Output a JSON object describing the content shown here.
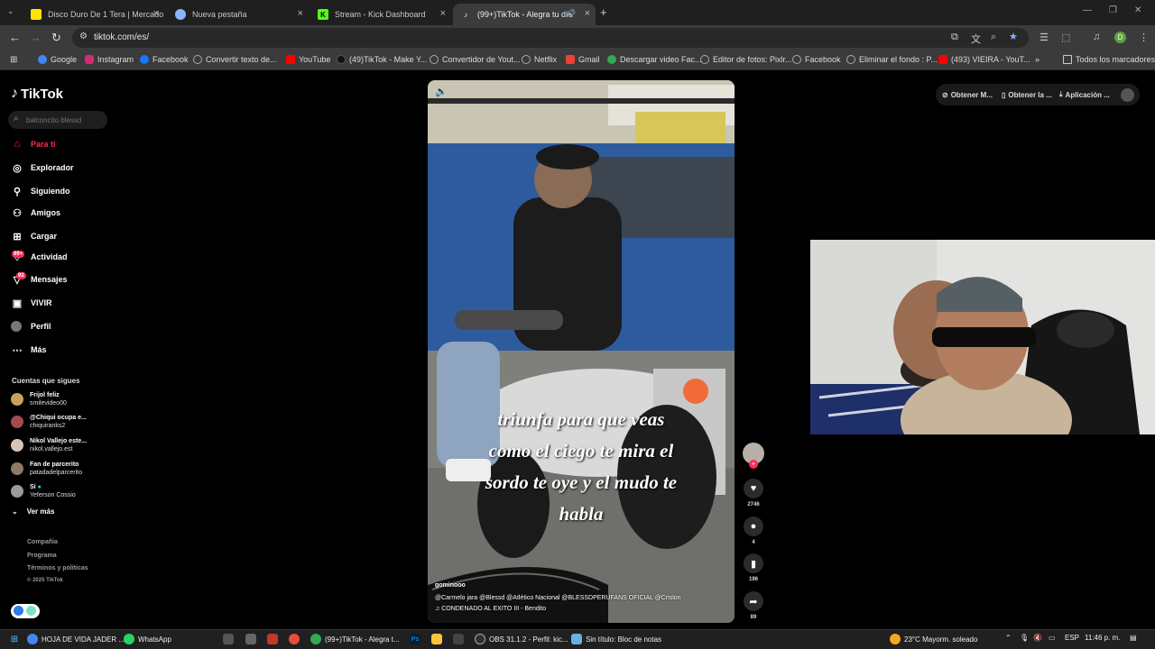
{
  "tabs": [
    {
      "title": "Disco Duro De 1 Tera | Mercado",
      "icon": "mercadolibre-icon",
      "color": "#ffe600"
    },
    {
      "title": "Nueva pestaña",
      "icon": "chrome-icon",
      "color": "#8ab4f8"
    },
    {
      "title": "Stream - Kick Dashboard",
      "icon": "kick-icon",
      "color": "#53fc18"
    },
    {
      "title": "(99+)TikTok - Alegra tu día",
      "icon": "tiktok-icon",
      "color": "#000000"
    }
  ],
  "address_bar": {
    "url": "tiktok.com/es/"
  },
  "bookmarks": [
    {
      "label": "Google",
      "color": "#4285f4"
    },
    {
      "label": "Instagram",
      "color": "#d62976"
    },
    {
      "label": "Facebook",
      "color": "#1877f2"
    },
    {
      "label": "Convertir texto de...",
      "color": "#9aa0a6"
    },
    {
      "label": "YouTube",
      "color": "#ff0000"
    },
    {
      "label": "(49)TikTok - Make Y...",
      "color": "#111111"
    },
    {
      "label": "Convertidor de Yout...",
      "color": "#9aa0a6"
    },
    {
      "label": "Netflix",
      "color": "#9aa0a6"
    },
    {
      "label": "Gmail",
      "color": "#ea4335"
    },
    {
      "label": "Descargar video Fac...",
      "color": "#34a853"
    },
    {
      "label": "Editor de fotos: Pixlr...",
      "color": "#9aa0a6"
    },
    {
      "label": "Facebook",
      "color": "#9aa0a6"
    },
    {
      "label": "Eliminar el fondo : P...",
      "color": "#9aa0a6"
    },
    {
      "label": "(493) VIEIRA - YouT...",
      "color": "#ff0000"
    }
  ],
  "bookmarks_all": "Todos los marcadores",
  "tiktok": {
    "logo": "TikTok",
    "search_placeholder": "balconcito blessd",
    "nav": [
      {
        "label": "Para ti",
        "icon": "home-icon",
        "badge": ""
      },
      {
        "label": "Explorador",
        "icon": "compass-icon",
        "badge": ""
      },
      {
        "label": "Siguiendo",
        "icon": "following-icon",
        "badge": ""
      },
      {
        "label": "Amigos",
        "icon": "friends-icon",
        "badge": ""
      },
      {
        "label": "Cargar",
        "icon": "upload-icon",
        "badge": ""
      },
      {
        "label": "Actividad",
        "icon": "activity-icon",
        "badge": "99+"
      },
      {
        "label": "Mensajes",
        "icon": "messages-icon",
        "badge": "92"
      },
      {
        "label": "VIVIR",
        "icon": "live-icon",
        "badge": ""
      },
      {
        "label": "Perfil",
        "icon": "profile-icon",
        "badge": ""
      },
      {
        "label": "Más",
        "icon": "more-icon",
        "badge": ""
      }
    ],
    "following_header": "Cuentas que sigues",
    "following": [
      {
        "name": "Frijol feliz",
        "user": "smilevideo00"
      },
      {
        "name": "@Chiqui ocupa e...",
        "user": "chiquiranks2"
      },
      {
        "name": "Nikol Vallejo este...",
        "user": "nikol.vallejo.est"
      },
      {
        "name": "Fan de parcerito",
        "user": "patadadelparcerito"
      },
      {
        "name": "Sí",
        "user": "Yeferson Cossio"
      }
    ],
    "see_more": "Ver más",
    "footer": [
      "Compañía",
      "Programa",
      "Términos y políticas",
      "© 2025 TikTok"
    ],
    "top_right": [
      "Obtener M...",
      "Obtener la ...",
      "Aplicación ..."
    ],
    "video": {
      "caption_lines": [
        "triunfa para que veas",
        "como el ciego te mira el",
        "sordo te oye y el mudo  te",
        "habla"
      ],
      "author": "gominooo",
      "description": "@Carmelo jara  @Blessd  @Atlético Nacional  @BLESSDPERUFANS OFICIAL  @Crislon",
      "sound": "♫ CONDENADO AL EXITO III - Bendito"
    },
    "actions": {
      "likes": "2746",
      "comments": "4",
      "saves": "196",
      "shares": "89"
    }
  },
  "taskbar": {
    "items": [
      "HOJA DE VIDA JADER ...",
      "WhatsApp",
      "(99+)TikTok - Alegra t...",
      "OBS 31.1.2 - Perfil: kic...",
      "Sin título: Bloc de notas"
    ],
    "weather": "23°C  Mayorm. soleado",
    "lang": "ESP",
    "time": "11:46 p. m."
  }
}
